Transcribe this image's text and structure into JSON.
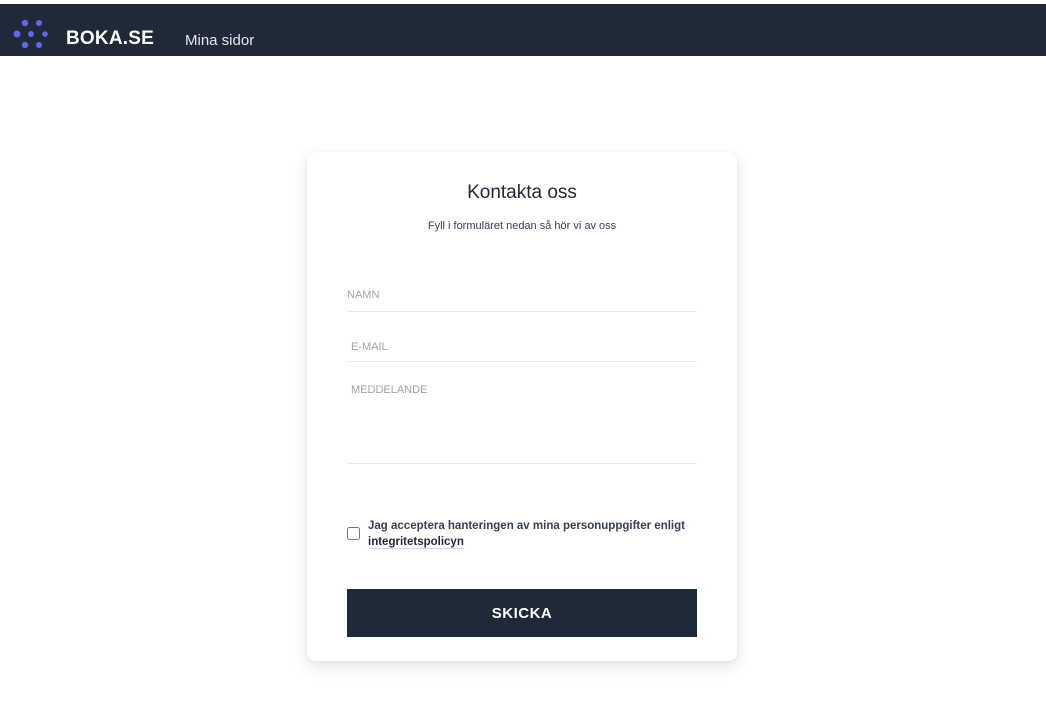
{
  "header": {
    "logo_icon": "dots-network-icon",
    "brand": "BOKA.SE",
    "nav_link": "Mina sidor",
    "colors": {
      "background": "#1f2937",
      "logo": "#6366f1"
    }
  },
  "contact_form": {
    "title": "Kontakta oss",
    "subtitle": "Fyll i formuläret nedan så hör vi av oss",
    "name_placeholder": "NAMN",
    "email_placeholder": "E-MAIL",
    "message_placeholder": "MEDDELANDE",
    "consent_text": "Jag acceptera hanteringen av mina personuppgifter enligt",
    "consent_link": "integritetspolicyn",
    "consent_checked": false,
    "submit_label": "SKICKA",
    "colors": {
      "button": "#1f2937",
      "button_text": "#ffffff"
    }
  }
}
